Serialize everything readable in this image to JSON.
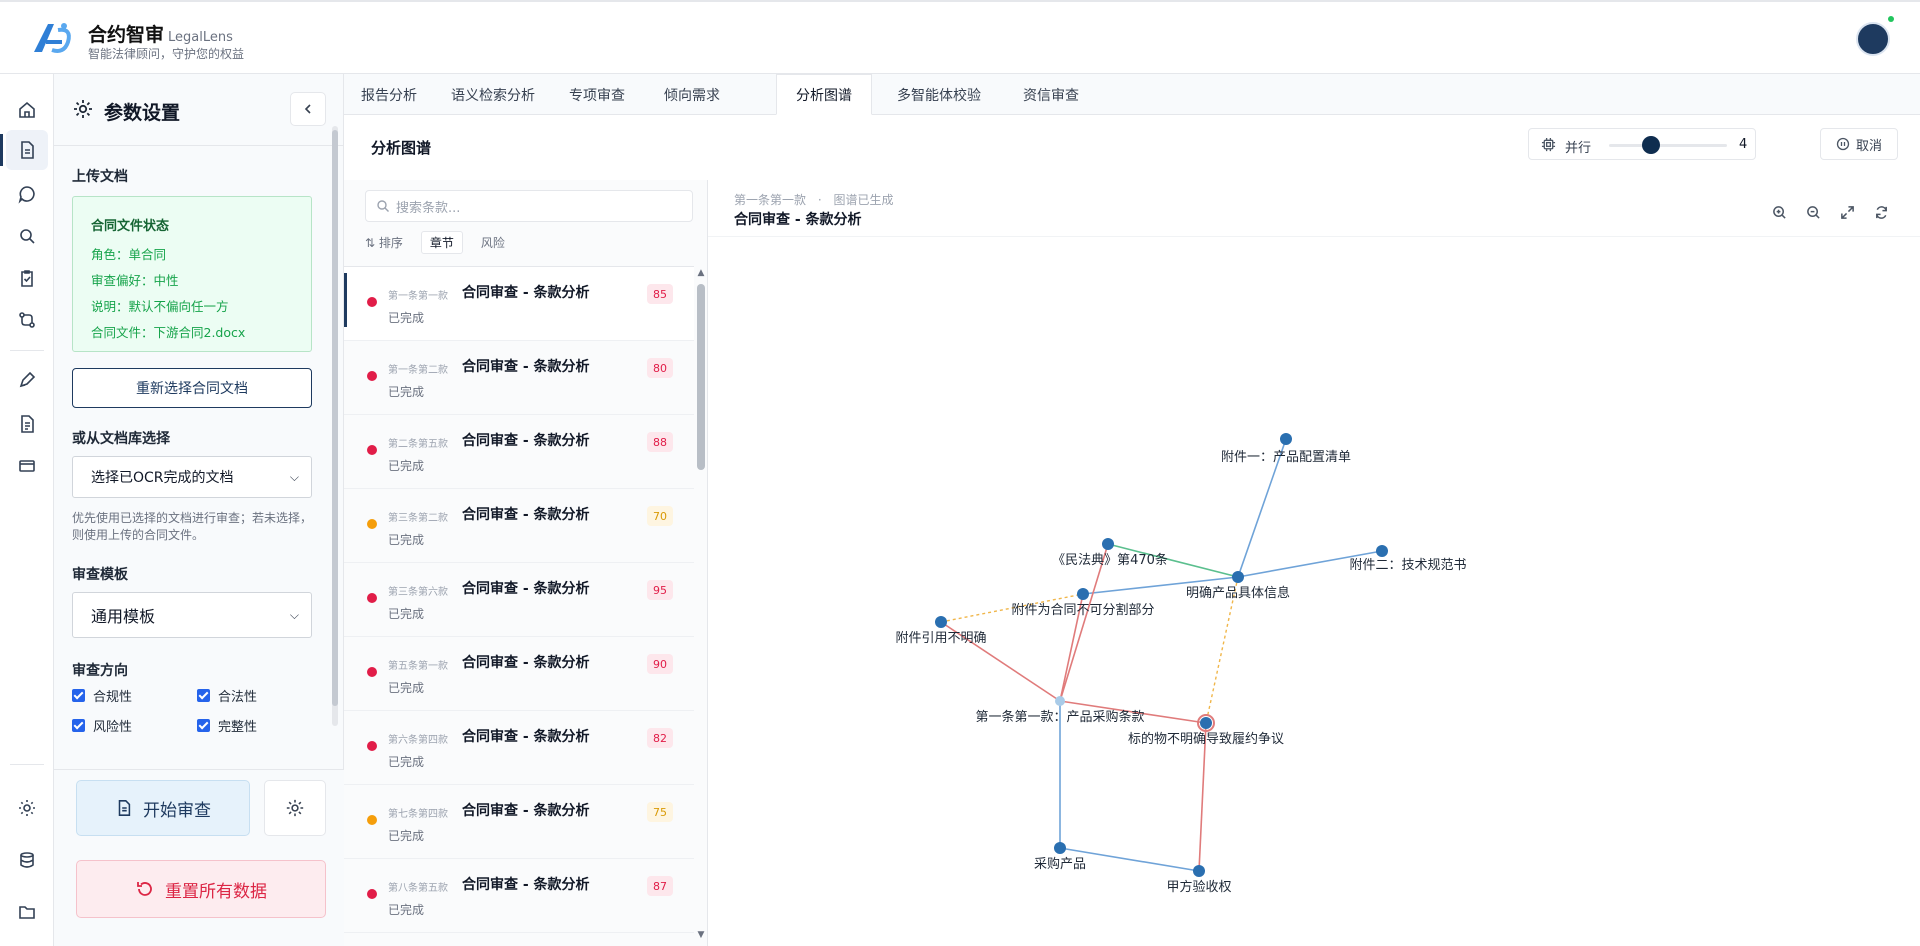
{
  "app": {
    "name": "合约智审",
    "name_en": "LegalLens",
    "subtitle": "智能法律顾问，守护您的权益"
  },
  "rail": {
    "items": [
      "home-icon",
      "document-icon",
      "chat-icon",
      "search-icon",
      "clipboard-check-icon",
      "git-compare-icon",
      "pen-icon",
      "file-text-icon",
      "card-icon",
      "settings-icon",
      "database-icon",
      "folder-icon"
    ],
    "active": "document-icon"
  },
  "settings": {
    "title": "参数设置",
    "upload_label": "上传文档",
    "status": {
      "title": "合同文件状态",
      "rows": [
        "角色：单合同",
        "审查偏好：中性",
        "说明：默认不偏向任一方",
        "合同文件：下游合同2.docx"
      ]
    },
    "reselect_button": "重新选择合同文档",
    "library_label": "或从文档库选择",
    "library_select": "选择已OCR完成的文档",
    "hint": "优先使用已选择的文档进行审查；若未选择，则使用上传的合同文件。",
    "template_label": "审查模板",
    "template_select": "通用模板",
    "direction_label": "审查方向",
    "checks": [
      "合规性",
      "合法性",
      "风险性",
      "完整性"
    ],
    "start_button": "开始审查",
    "reset_button": "重置所有数据"
  },
  "tabs": [
    "报告分析",
    "语义检索分析",
    "专项审查",
    "倾向需求",
    "分析图谱",
    "多智能体校验",
    "资信审查"
  ],
  "active_tab": "分析图谱",
  "content": {
    "title": "分析图谱",
    "parallel_label": "并行",
    "parallel_value": "4",
    "parallel_level": 0.36,
    "cancel": "取消"
  },
  "clauses": {
    "search_placeholder": "搜索条款...",
    "sort_label": "排序",
    "sort_options": [
      "章节",
      "风险"
    ],
    "sort_selected": "章节",
    "items": [
      {
        "code": "第一条第一款",
        "name": "合同审查 - 条款分析",
        "state": "已完成",
        "score": "85",
        "level": "red"
      },
      {
        "code": "第一条第二款",
        "name": "合同审查 - 条款分析",
        "state": "已完成",
        "score": "80",
        "level": "red"
      },
      {
        "code": "第二条第五款",
        "name": "合同审查 - 条款分析",
        "state": "已完成",
        "score": "88",
        "level": "red"
      },
      {
        "code": "第三条第二款",
        "name": "合同审查 - 条款分析",
        "state": "已完成",
        "score": "70",
        "level": "orange"
      },
      {
        "code": "第三条第六款",
        "name": "合同审查 - 条款分析",
        "state": "已完成",
        "score": "95",
        "level": "red"
      },
      {
        "code": "第五条第一款",
        "name": "合同审查 - 条款分析",
        "state": "已完成",
        "score": "90",
        "level": "red"
      },
      {
        "code": "第六条第四款",
        "name": "合同审查 - 条款分析",
        "state": "已完成",
        "score": "82",
        "level": "red"
      },
      {
        "code": "第七条第四款",
        "name": "合同审查 - 条款分析",
        "state": "已完成",
        "score": "75",
        "level": "orange"
      },
      {
        "code": "第八条第五款",
        "name": "合同审查 - 条款分析",
        "state": "已完成",
        "score": "87",
        "level": "red"
      }
    ]
  },
  "graph": {
    "breadcrumb_a": "第一条第一款",
    "breadcrumb_sep": "·",
    "breadcrumb_b": "图谱已生成",
    "title": "合同审查 - 条款分析",
    "tools": [
      "zoom-in-icon",
      "zoom-out-icon",
      "expand-icon",
      "refresh-icon"
    ],
    "nodes": [
      {
        "id": "n1",
        "label": "附件一：产品配置清单"
      },
      {
        "id": "n2",
        "label": "《民法典》第470条"
      },
      {
        "id": "n3",
        "label": "附件二：技术规范书"
      },
      {
        "id": "n4",
        "label": "明确产品具体信息"
      },
      {
        "id": "n5",
        "label": "附件为合同不可分割部分"
      },
      {
        "id": "n6",
        "label": "附件引用不明确"
      },
      {
        "id": "n7",
        "label": "第一条第一款：产品采购条款"
      },
      {
        "id": "n8",
        "label": "标的物不明确导致履约争议"
      },
      {
        "id": "n9",
        "label": "采购产品"
      },
      {
        "id": "n10",
        "label": "甲方验收权"
      }
    ],
    "colors": {
      "blue": "#6fa3d8",
      "red": "#e07b7b",
      "green": "#5bbf8e",
      "orange_dash": "#f0b64a",
      "node": "#2a6fb0"
    }
  }
}
